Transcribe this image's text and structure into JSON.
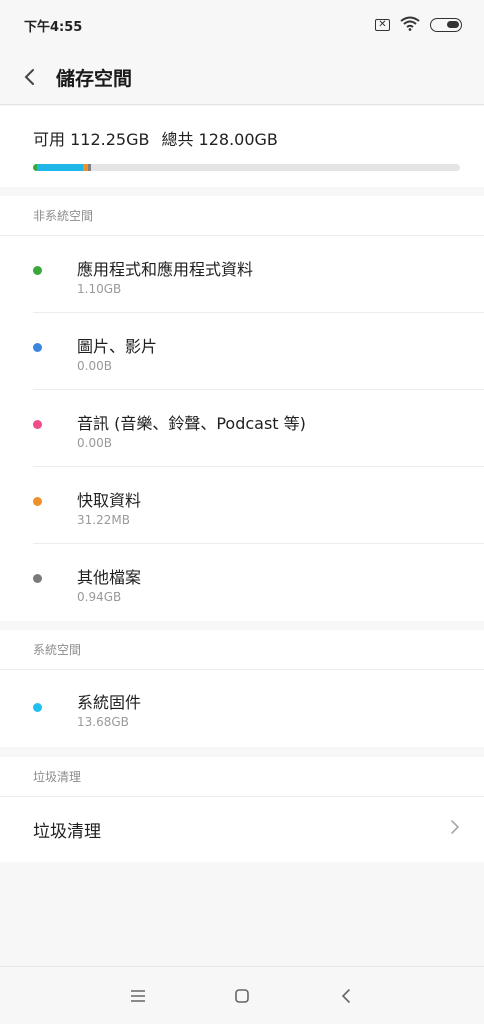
{
  "status": {
    "time": "下午4:55"
  },
  "header": {
    "title": "儲存空間"
  },
  "summary": {
    "available": "可用 112.25GB",
    "total": "總共 128.00GB"
  },
  "usage_segments": [
    {
      "name": "apps",
      "color": "#3aa83a",
      "fraction": 0.009
    },
    {
      "name": "system",
      "color": "#1fb7e8",
      "fraction": 0.107
    },
    {
      "name": "cache",
      "color": "#f0902a",
      "fraction": 0.012
    },
    {
      "name": "other",
      "color": "#808080",
      "fraction": 0.0073
    }
  ],
  "non_system": {
    "header": "非系統空間",
    "items": [
      {
        "label": "應用程式和應用程式資料",
        "size": "1.10GB",
        "color": "#3aa83a"
      },
      {
        "label": "圖片、影片",
        "size": "0.00B",
        "color": "#3b87e0"
      },
      {
        "label": "音訊 (音樂、鈴聲、Podcast 等)",
        "size": "0.00B",
        "color": "#ee4c8a"
      },
      {
        "label": "快取資料",
        "size": "31.22MB",
        "color": "#f0902a"
      },
      {
        "label": "其他檔案",
        "size": "0.94GB",
        "color": "#7a7a7a"
      }
    ]
  },
  "system": {
    "header": "系統空間",
    "items": [
      {
        "label": "系統固件",
        "size": "13.68GB",
        "color": "#1fc0ee"
      }
    ]
  },
  "junk": {
    "header": "垃圾清理",
    "row_label": "垃圾清理"
  }
}
